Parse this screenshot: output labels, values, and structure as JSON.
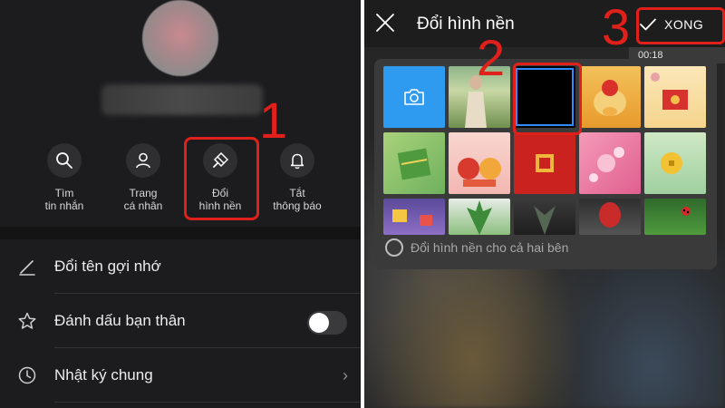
{
  "left_panel": {
    "actions": [
      {
        "label": "Tìm\ntin nhắn",
        "icon": "search-icon"
      },
      {
        "label": "Trang\ncá nhân",
        "icon": "user-icon"
      },
      {
        "label": "Đổi\nhình nền",
        "icon": "paintbrush-icon"
      },
      {
        "label": "Tắt\nthông báo",
        "icon": "bell-icon"
      }
    ],
    "rows": [
      {
        "label": "Đổi tên gợi nhớ",
        "icon": "pencil-icon"
      },
      {
        "label": "Đánh dấu bạn thân",
        "icon": "star-icon",
        "toggle_on": false
      },
      {
        "label": "Nhật ký chung",
        "icon": "clock-icon"
      }
    ],
    "chevron": "›"
  },
  "right_panel": {
    "title": "Đổi hình nền",
    "done_label": "XONG",
    "video_time": "00:18",
    "both_sides_label": "Đổi hình nền cho cả hai bên",
    "tiles": [
      {
        "kind": "camera",
        "color": "#2e9bf0"
      },
      {
        "kind": "photo-girl"
      },
      {
        "kind": "black",
        "selected": true
      },
      {
        "kind": "ox-yellow"
      },
      {
        "kind": "lucky-envelope"
      },
      {
        "kind": "banh-chung"
      },
      {
        "kind": "two-oxen"
      },
      {
        "kind": "red-envelope"
      },
      {
        "kind": "peach-flowers"
      },
      {
        "kind": "gold-coin"
      },
      {
        "kind": "purple-gift"
      },
      {
        "kind": "green-leaves"
      },
      {
        "kind": "dark-plant"
      },
      {
        "kind": "red-tulip"
      },
      {
        "kind": "ladybug-leaf"
      }
    ]
  },
  "annotations": {
    "step1": "1",
    "step2": "2",
    "step3": "3",
    "color": "#e0201b"
  }
}
